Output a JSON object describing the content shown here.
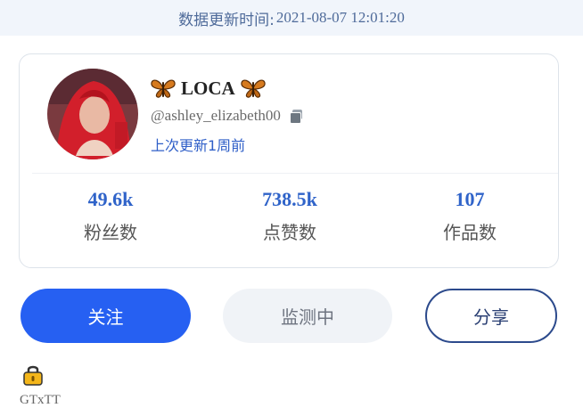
{
  "banner": {
    "label": "数据更新时间:",
    "time": "2021-08-07 12:01:20"
  },
  "profile": {
    "name": "LOCA",
    "handle": "@ashley_elizabeth00",
    "updated": "上次更新1周前"
  },
  "stats": [
    {
      "value": "49.6k",
      "label": "粉丝数"
    },
    {
      "value": "738.5k",
      "label": "点赞数"
    },
    {
      "value": "107",
      "label": "作品数"
    }
  ],
  "buttons": {
    "follow": "关注",
    "monitoring": "监测中",
    "share": "分享"
  },
  "bottom": {
    "text": "GTxTT"
  },
  "colors": {
    "accent": "#2660f2",
    "stat_number": "#2f63c9",
    "banner_bg": "#f1f5fb"
  }
}
